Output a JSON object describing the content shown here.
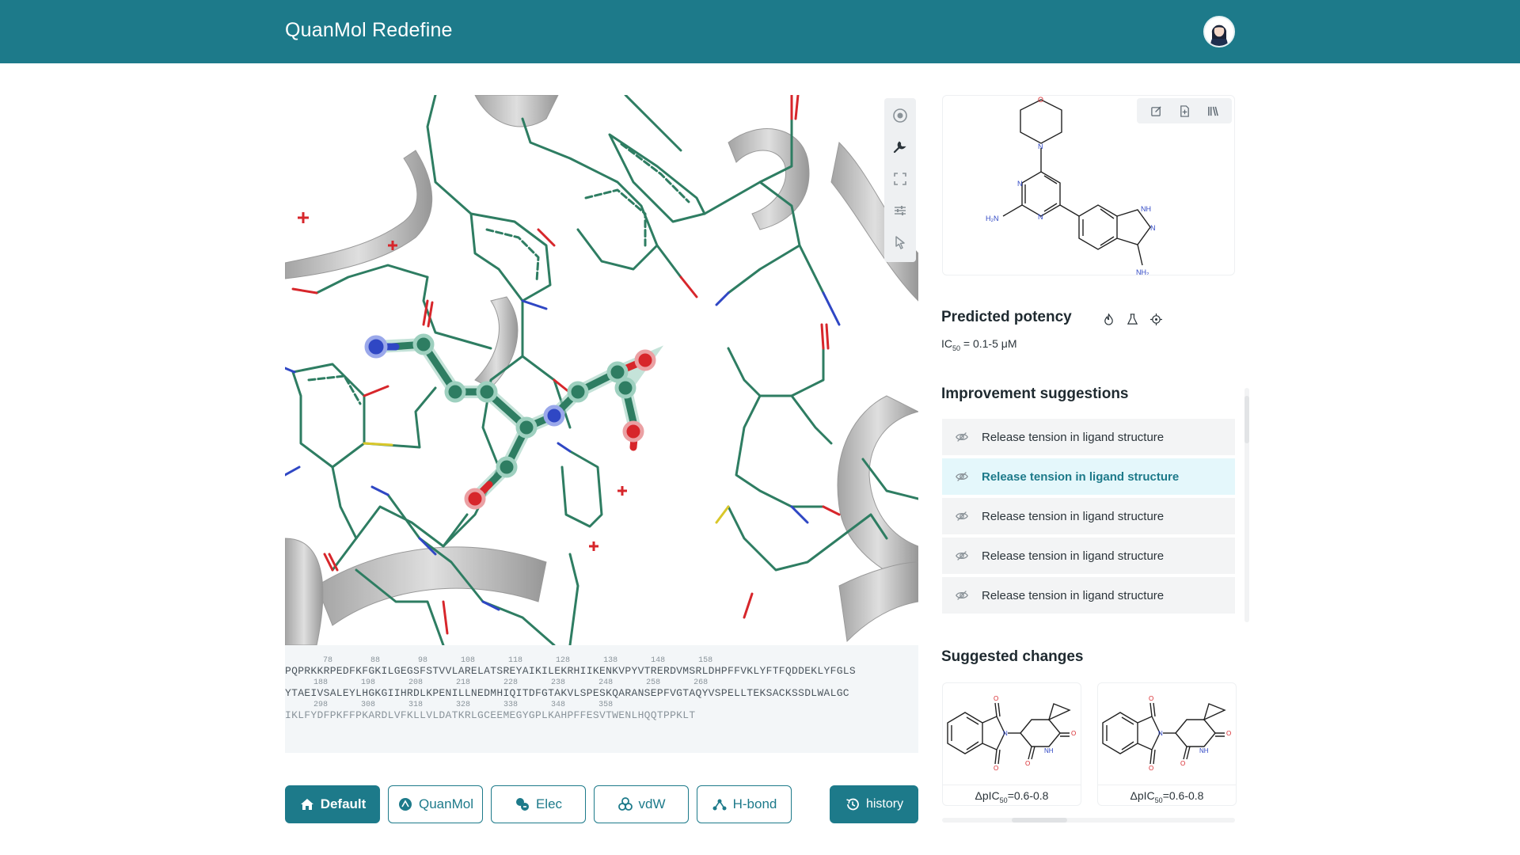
{
  "app": {
    "title": "QuanMol Redefine"
  },
  "viewer": {
    "tools": [
      "target-icon",
      "wrench-icon",
      "fullscreen-icon",
      "sliders-icon",
      "pointer-icon"
    ]
  },
  "sequence": {
    "rows": [
      {
        "numbers": "        78        88        98       108       118       128       138       148       158",
        "text": "PQPRKKRPEDFKFGKILGEGSFSTVVLARELATSREYAIKILEKRHIIKENKVPYVTRERDVMSRLDHPFFVKLYFTFQDDEKLYFGLS"
      },
      {
        "numbers": "      188       198       208       218       228       238       248       258       268",
        "text": "YTAEIVSALEYLHGKGIIHRDLKPENILLNEDMHIQITDFGTAKVLSPESKQARANSEPFVGTAQYVSPELLTEKSACKSSDLWALGC"
      },
      {
        "numbers": "      298       308       318       328       338       348       358",
        "text": "IKLFYDFPKFFPKARDLVFKLLVLDATKRLGCEEMEGYGPLKAHPFFESVTWENLHQQTPPKLT"
      }
    ]
  },
  "modes": [
    {
      "label": "Default",
      "icon": "home-icon",
      "active": true
    },
    {
      "label": "QuanMol",
      "icon": "atom-icon",
      "active": false
    },
    {
      "label": "Elec",
      "icon": "charge-icon",
      "active": false
    },
    {
      "label": "vdW",
      "icon": "spheres-icon",
      "active": false
    },
    {
      "label": "H-bond",
      "icon": "bond-icon",
      "active": false
    }
  ],
  "history": {
    "label": "history",
    "icon": "history-icon"
  },
  "molecule": {
    "atoms": {
      "o": "O",
      "n": "N",
      "nh": "NH",
      "h2n": "H₂N",
      "nh2": "NH₂"
    },
    "actions": [
      "edit-icon",
      "add-file-icon",
      "library-icon"
    ]
  },
  "potency": {
    "title": "Predicted potency",
    "value_prefix": "IC",
    "value_sub": "50",
    "value_suffix": " = 0.1-5 μM",
    "icons": [
      "flame-icon",
      "flask-icon",
      "crosshair-icon"
    ]
  },
  "improvements": {
    "title": "Improvement suggestions",
    "items": [
      {
        "label": "Release tension in ligand structure",
        "selected": false
      },
      {
        "label": "Release tension in ligand structure",
        "selected": true
      },
      {
        "label": "Release tension in ligand structure",
        "selected": false
      },
      {
        "label": "Release tension in ligand structure",
        "selected": false
      },
      {
        "label": "Release tension in ligand structure",
        "selected": false
      }
    ]
  },
  "changes": {
    "title": "Suggested changes",
    "atoms": {
      "o": "O",
      "n": "N",
      "nh": "NH"
    },
    "items": [
      {
        "prefix": "ΔpIC",
        "sub": "50",
        "value": "=0.6-0.8"
      },
      {
        "prefix": "ΔpIC",
        "sub": "50",
        "value": "=0.6-0.8"
      }
    ]
  },
  "colors": {
    "brand": "#1d7a8a",
    "carbon": "#2e7d62",
    "oxygen": "#d7262b",
    "nitrogen": "#2f47c4",
    "sulfur": "#d9c72a",
    "ribbon": "#b8b8b8"
  }
}
